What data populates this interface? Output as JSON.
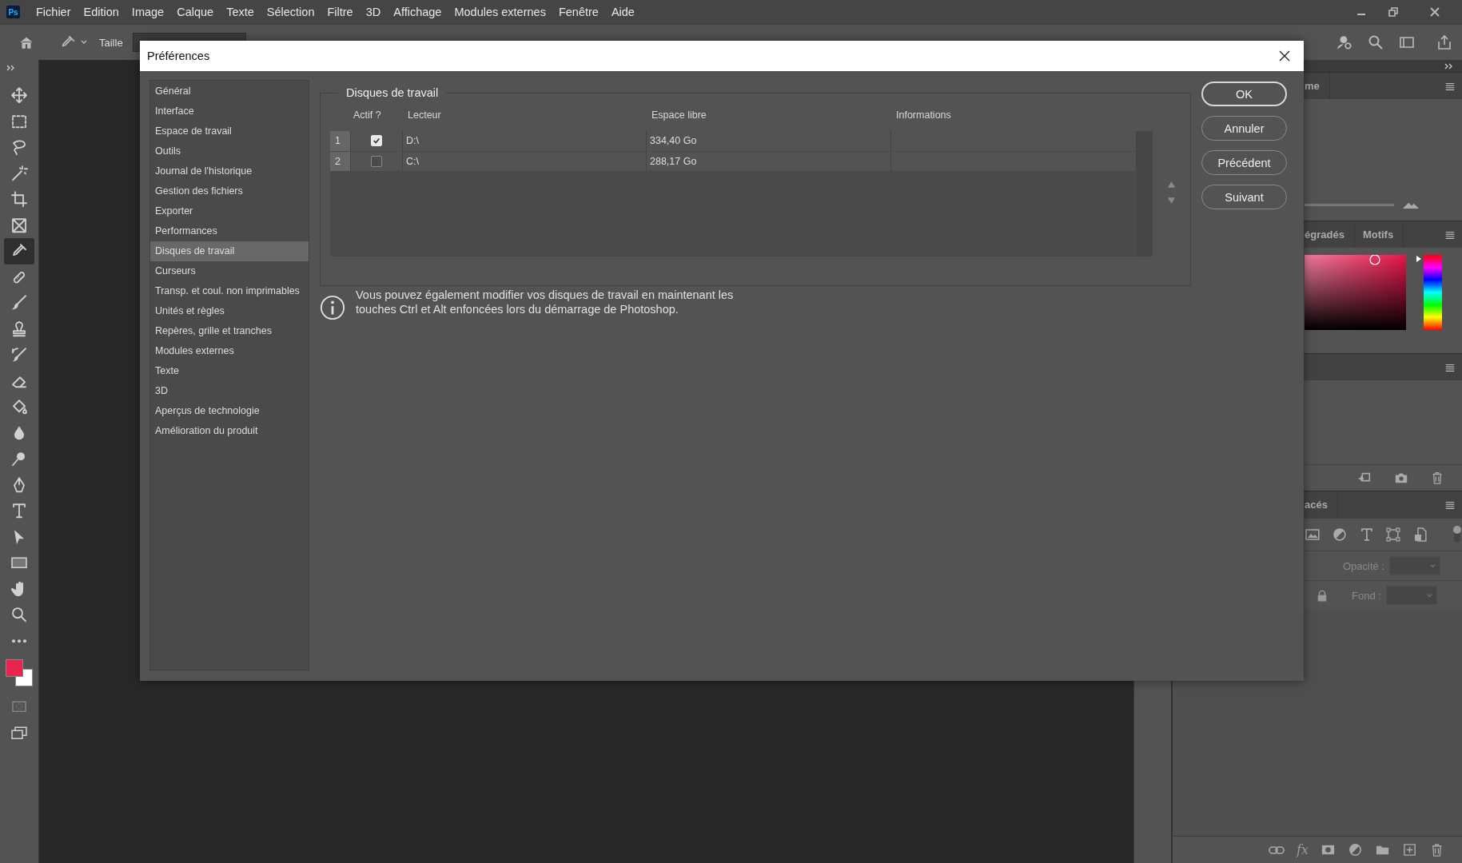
{
  "app": {
    "logo": "Ps",
    "menu": [
      "Fichier",
      "Edition",
      "Image",
      "Calque",
      "Texte",
      "Sélection",
      "Filtre",
      "3D",
      "Affichage",
      "Modules externes",
      "Fenêtre",
      "Aide"
    ]
  },
  "options_bar": {
    "size_label": "Taille"
  },
  "tools": [
    {
      "kind": "move",
      "selected": false
    },
    {
      "kind": "marquee",
      "selected": false
    },
    {
      "kind": "lasso",
      "selected": false
    },
    {
      "kind": "wand",
      "selected": false
    },
    {
      "kind": "crop",
      "selected": false
    },
    {
      "kind": "frame",
      "selected": false
    },
    {
      "kind": "eyedropper",
      "selected": true
    },
    {
      "kind": "healing",
      "selected": false
    },
    {
      "kind": "brush",
      "selected": false
    },
    {
      "kind": "stamp",
      "selected": false
    },
    {
      "kind": "history",
      "selected": false
    },
    {
      "kind": "eraser",
      "selected": false
    },
    {
      "kind": "bucket",
      "selected": false
    },
    {
      "kind": "blur",
      "selected": false
    },
    {
      "kind": "dodge",
      "selected": false
    },
    {
      "kind": "pen",
      "selected": false
    },
    {
      "kind": "type",
      "selected": false
    },
    {
      "kind": "select",
      "selected": false
    },
    {
      "kind": "rectangle",
      "selected": false
    },
    {
      "kind": "hand",
      "selected": false
    },
    {
      "kind": "zoom",
      "selected": false
    },
    {
      "kind": "more",
      "selected": false
    }
  ],
  "swatches": [
    {
      "color": "#e8254f"
    },
    {
      "color": "#ffffff"
    }
  ],
  "preferences": {
    "title": "Préférences",
    "categories": [
      {
        "label": "Général",
        "selected": false
      },
      {
        "label": "Interface",
        "selected": false
      },
      {
        "label": "Espace de travail",
        "selected": false
      },
      {
        "label": "Outils",
        "selected": false
      },
      {
        "label": "Journal de l'historique",
        "selected": false
      },
      {
        "label": "Gestion des fichiers",
        "selected": false
      },
      {
        "label": "Exporter",
        "selected": false
      },
      {
        "label": "Performances",
        "selected": false
      },
      {
        "label": "Disques de travail",
        "selected": true
      },
      {
        "label": "Curseurs",
        "selected": false
      },
      {
        "label": "Transp. et coul. non imprimables",
        "selected": false
      },
      {
        "label": "Unités et règles",
        "selected": false
      },
      {
        "label": "Repères, grille et tranches",
        "selected": false
      },
      {
        "label": "Modules externes",
        "selected": false
      },
      {
        "label": "Texte",
        "selected": false
      },
      {
        "label": "3D",
        "selected": false
      },
      {
        "label": "Aperçus de technologie",
        "selected": false
      },
      {
        "label": "Amélioration du produit",
        "selected": false
      }
    ],
    "group_title": "Disques de travail",
    "columns": [
      "Actif ?",
      "Lecteur",
      "Espace libre",
      "Informations"
    ],
    "rows": [
      {
        "index": "1",
        "checked": true,
        "drive": "D:\\",
        "free": "334,40 Go"
      },
      {
        "index": "2",
        "checked": false,
        "drive": "C:\\",
        "free": "288,17 Go"
      }
    ],
    "note": "Vous pouvez également modifier vos disques de travail en maintenant les touches Ctrl et Alt enfoncées lors du démarrage de Photoshop.",
    "buttons": [
      {
        "label": "OK",
        "default": true
      },
      {
        "label": "Annuler",
        "default": false
      },
      {
        "label": "Précédent",
        "default": false
      },
      {
        "label": "Suivant",
        "default": false
      }
    ]
  },
  "panels": [
    {
      "kind": "adjust",
      "tabs": [
        {
          "label": "me"
        }
      ]
    },
    {
      "kind": "color",
      "tabs": [
        {
          "label": "égradés"
        },
        {
          "label": "Motifs"
        }
      ],
      "level": 1
    },
    {
      "kind": "history"
    },
    {
      "kind": "layers",
      "tabs": [
        {
          "label": "acés"
        }
      ],
      "opacity_label": "Opacité :",
      "fill_label": "Fond :",
      "fx": "fx"
    }
  ]
}
